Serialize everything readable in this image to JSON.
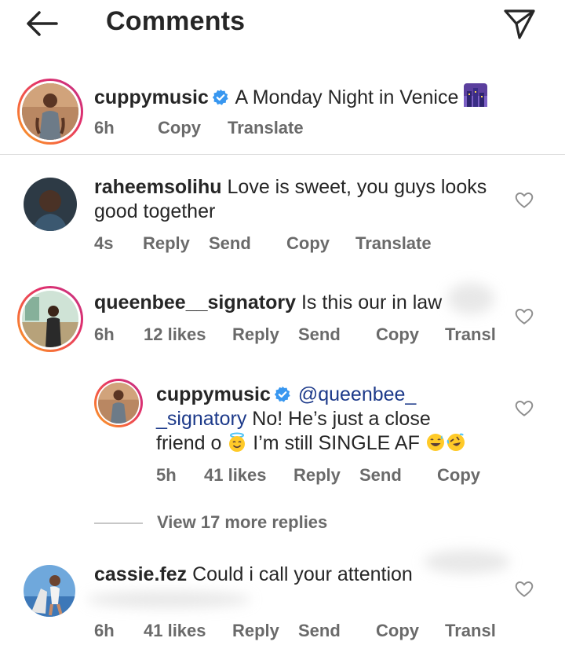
{
  "header": {
    "title": "Comments",
    "back_icon": "arrow-left-icon",
    "share_icon": "paper-plane-icon"
  },
  "caption": {
    "username": "cuppymusic",
    "verified": true,
    "text": "A Monday Night in Venice",
    "emoji": "night-city-emoji",
    "time": "6h",
    "copy": "Copy",
    "translate": "Translate"
  },
  "comments": [
    {
      "username": "raheemsolihu",
      "text_line1": "Love is sweet, you guys looks",
      "text_line2": "good together",
      "time": "4s",
      "reply": "Reply",
      "send": "Send",
      "copy": "Copy",
      "translate": "Translate"
    },
    {
      "username": "queenbee__signatory",
      "text": "Is this our in law",
      "time": "6h",
      "likes": "12 likes",
      "reply": "Reply",
      "send": "Send",
      "copy": "Copy",
      "translate": "Transl"
    },
    {
      "username": "cassie.fez",
      "text": "Could i call your attention",
      "time": "6h",
      "likes": "41 likes",
      "reply": "Reply",
      "send": "Send",
      "copy": "Copy",
      "translate": "Transl"
    }
  ],
  "reply": {
    "username": "cuppymusic",
    "verified": true,
    "mention_part1": "@queenbee_",
    "mention_part2": "_signatory",
    "text_line2": " No! He’s just a close",
    "text_line3a": "friend o",
    "text_line3b": "I’m still SINGLE AF",
    "time": "5h",
    "likes": "41 likes",
    "reply": "Reply",
    "send": "Send",
    "copy": "Copy"
  },
  "view_more": "View 17 more replies",
  "colors": {
    "verified_blue": "#3897f0",
    "mention_blue": "#1d3a8a",
    "meta_gray": "#6a6a6a",
    "divider": "#dbdbdb"
  }
}
